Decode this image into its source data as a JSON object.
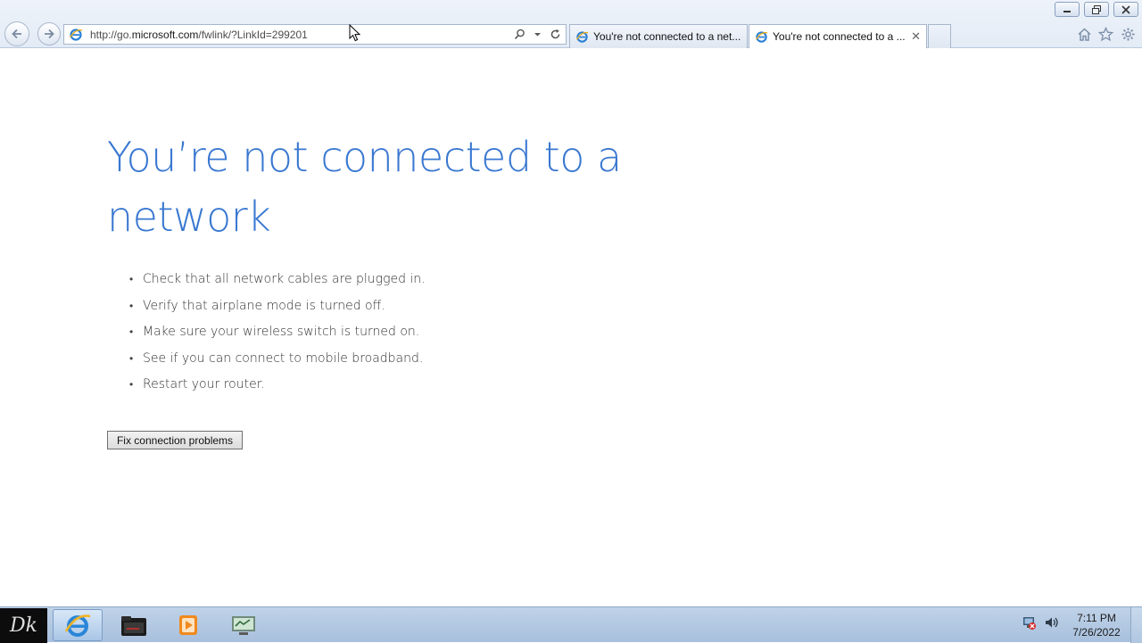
{
  "browser": {
    "address": {
      "url_prefix": "http://go.",
      "url_domain": "microsoft.com",
      "url_path": "/fwlink/?LinkId=299201"
    },
    "tabs": [
      {
        "title": "You're not connected to a net...",
        "icon": "ie-page-icon"
      },
      {
        "title": "You're not connected to a ...",
        "icon": "ie-page-icon",
        "active": true,
        "close_label": "✕"
      }
    ],
    "toolbar_icons": [
      "home-icon",
      "favorites-star-icon",
      "gear-icon"
    ],
    "window_buttons": [
      "minimize",
      "restore",
      "close"
    ]
  },
  "page": {
    "heading": "You’re not connected to a network",
    "tips": [
      "Check that all network cables are plugged in.",
      "Verify that airplane mode is turned off.",
      "Make sure your wireless switch is turned on.",
      "See if you can connect to mobile broadband.",
      "Restart your router."
    ],
    "fix_button": "Fix connection problems",
    "heading_color": "#3a78d1"
  },
  "taskbar": {
    "start_label": "Dk",
    "apps": [
      "internet-explorer",
      "file-explorer",
      "media-player",
      "network-app"
    ],
    "tray_icons": [
      "network-disconnected-icon",
      "volume-icon"
    ],
    "time": "7:11 PM",
    "date": "7/26/2022"
  }
}
